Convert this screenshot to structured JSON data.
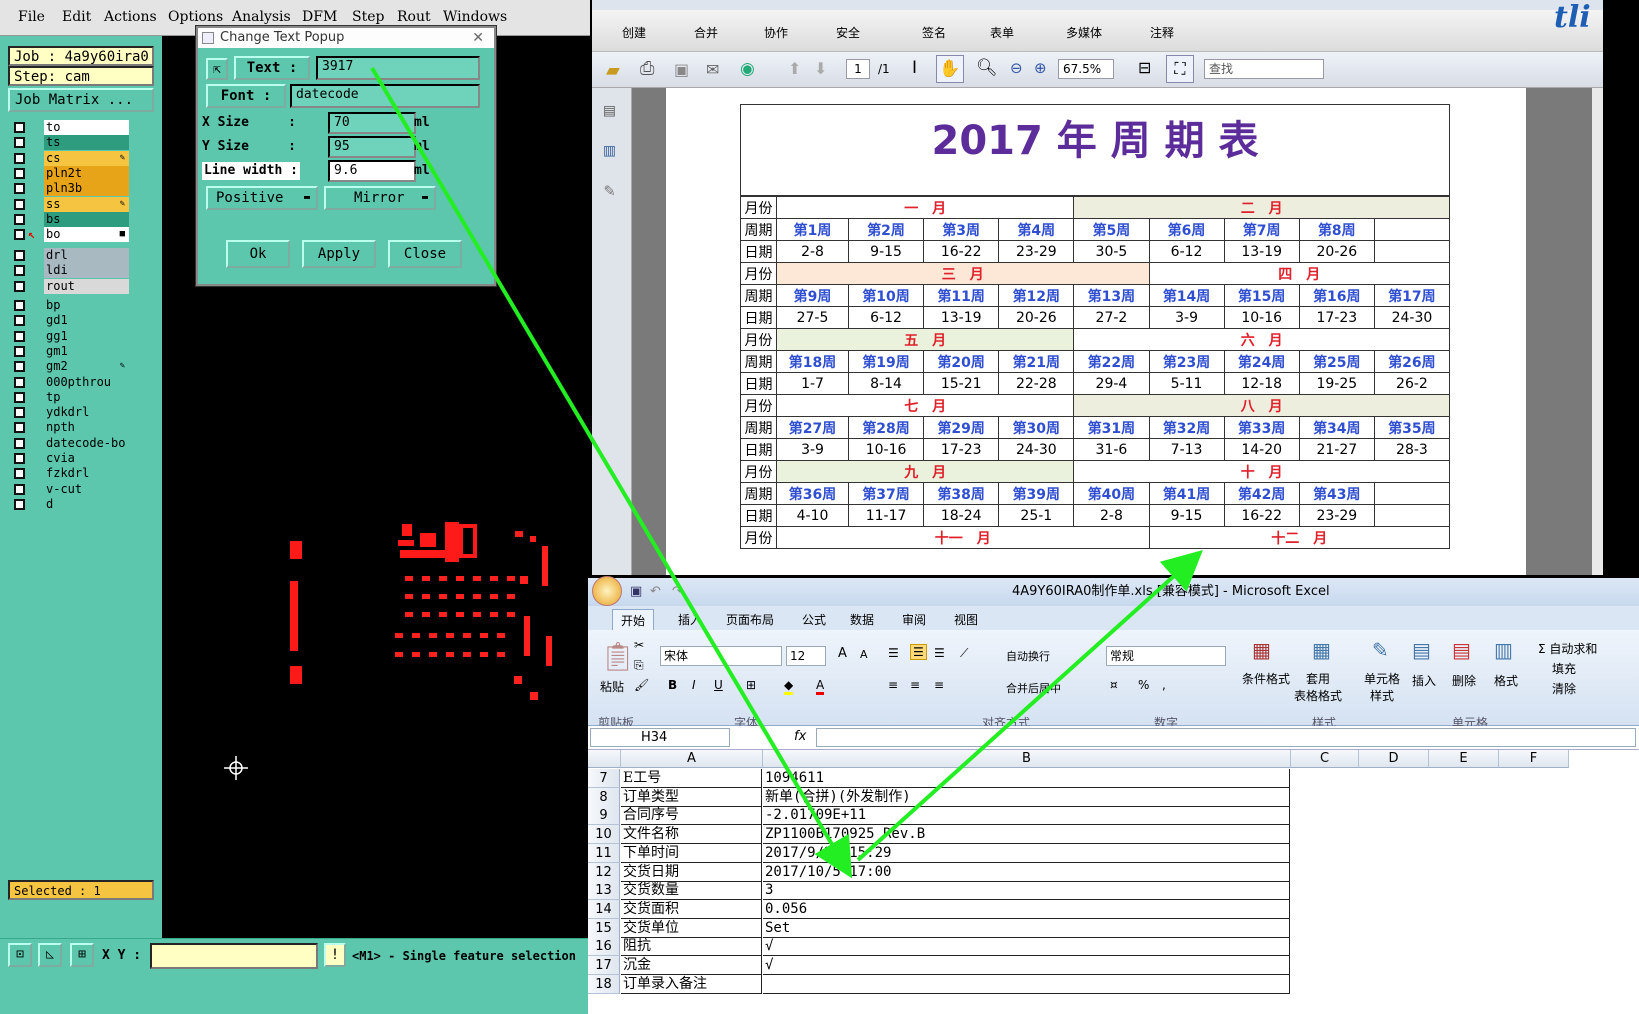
{
  "cam": {
    "menu": [
      "File",
      "Edit",
      "Actions",
      "Options",
      "Analysis",
      "DFM",
      "Step",
      "Rout",
      "Windows"
    ],
    "job": "Job : 4a9y60ira0",
    "step": "Step: cam",
    "job_matrix": "Job Matrix ...",
    "layers_a": [
      {
        "name": "to",
        "color": "#ffffff",
        "mark": ""
      },
      {
        "name": "ts",
        "color": "#2e9c7e",
        "mark": ""
      },
      {
        "name": "cs",
        "color": "#f5c542",
        "mark": "✎"
      },
      {
        "name": "pln2t",
        "color": "#e8a419",
        "mark": ""
      },
      {
        "name": "pln3b",
        "color": "#e8a419",
        "mark": ""
      },
      {
        "name": "ss",
        "color": "#f5c542",
        "mark": "✎"
      },
      {
        "name": "bs",
        "color": "#2e9c7e",
        "mark": ""
      },
      {
        "name": "bo",
        "color": "#ffffff",
        "mark": "■"
      }
    ],
    "layers_b": [
      {
        "name": "drl",
        "color": "#a8b9c2"
      },
      {
        "name": "ldi",
        "color": "#a8b9c2"
      },
      {
        "name": "rout",
        "color": "#d9d9d9"
      }
    ],
    "layers_c": [
      {
        "name": "bp",
        "mark": ""
      },
      {
        "name": "gd1",
        "mark": ""
      },
      {
        "name": "gg1",
        "mark": ""
      },
      {
        "name": "gm1",
        "mark": ""
      },
      {
        "name": "gm2",
        "mark": "✎"
      },
      {
        "name": "000pthrou",
        "mark": ""
      },
      {
        "name": "tp",
        "mark": ""
      },
      {
        "name": "ydkdrl",
        "mark": ""
      },
      {
        "name": "npth",
        "mark": ""
      },
      {
        "name": "datecode-bo",
        "mark": ""
      },
      {
        "name": "cvia",
        "mark": ""
      },
      {
        "name": "fzkdrl",
        "mark": ""
      },
      {
        "name": "v-cut",
        "mark": ""
      },
      {
        "name": "d",
        "mark": ""
      }
    ],
    "selected": "Selected : 1",
    "xy_label": "X Y :",
    "status": "<M1> - Single feature selection"
  },
  "dialog": {
    "title": "Change Text Popup",
    "text_label": "Text :",
    "text_value": "3917",
    "font_label": "Font :",
    "font_value": "datecode",
    "xsize_label": "X Size     :",
    "xsize_value": "70",
    "ysize_label": "Y Size     :",
    "ysize_value": "95",
    "linewidth_label": "Line width :",
    "linewidth_value": "9.6",
    "unit": "ml",
    "polarity": "Positive",
    "mirror": "Mirror",
    "ok": "Ok",
    "apply": "Apply",
    "close": "Close"
  },
  "pdf": {
    "toolbar": [
      "创建",
      "合并",
      "协作",
      "安全",
      "签名",
      "表单",
      "多媒体",
      "注释"
    ],
    "page_current": "1",
    "page_total": "/1",
    "zoom": "67.5%",
    "find_placeholder": "查找",
    "corner_text": "tli",
    "calendar_title": "2017 年 周 期 表",
    "row_month": "月份",
    "row_week": "周期",
    "row_date": "日期",
    "blocks": [
      {
        "months": [
          "一　月",
          "二　月"
        ],
        "split": 4,
        "weeks": [
          "第1周",
          "第2周",
          "第3周",
          "第4周",
          "第5周",
          "第6周",
          "第7周",
          "第8周",
          ""
        ],
        "dates": [
          "2-8",
          "9-15",
          "16-22",
          "23-29",
          "30-5",
          "6-12",
          "13-19",
          "20-26",
          ""
        ]
      },
      {
        "months": [
          "三　月",
          "四　月"
        ],
        "split": 5,
        "weeks": [
          "第9周",
          "第10周",
          "第11周",
          "第12周",
          "第13周",
          "第14周",
          "第15周",
          "第16周",
          "第17周"
        ],
        "dates": [
          "27-5",
          "6-12",
          "13-19",
          "20-26",
          "27-2",
          "3-9",
          "10-16",
          "17-23",
          "24-30"
        ]
      },
      {
        "months": [
          "五　月",
          "六　月"
        ],
        "split": 4,
        "weeks": [
          "第18周",
          "第19周",
          "第20周",
          "第21周",
          "第22周",
          "第23周",
          "第24周",
          "第25周",
          "第26周"
        ],
        "dates": [
          "1-7",
          "8-14",
          "15-21",
          "22-28",
          "29-4",
          "5-11",
          "12-18",
          "19-25",
          "26-2"
        ]
      },
      {
        "months": [
          "七　月",
          "八　月"
        ],
        "split": 4,
        "weeks": [
          "第27周",
          "第28周",
          "第29周",
          "第30周",
          "第31周",
          "第32周",
          "第33周",
          "第34周",
          "第35周"
        ],
        "dates": [
          "3-9",
          "10-16",
          "17-23",
          "24-30",
          "31-6",
          "7-13",
          "14-20",
          "21-27",
          "28-3"
        ]
      },
      {
        "months": [
          "九　月",
          "十　月"
        ],
        "split": 4,
        "weeks": [
          "第36周",
          "第37周",
          "第38周",
          "第39周",
          "第40周",
          "第41周",
          "第42周",
          "第43周",
          ""
        ],
        "dates": [
          "4-10",
          "11-17",
          "18-24",
          "25-1",
          "2-8",
          "9-15",
          "16-22",
          "23-29",
          ""
        ]
      }
    ],
    "last_months": [
      "十一　月",
      "十二　月"
    ]
  },
  "excel": {
    "title": "4A9Y60IRA0制作单.xls  [兼容模式] - Microsoft Excel",
    "tabs": [
      "开始",
      "插入",
      "页面布局",
      "公式",
      "数据",
      "审阅",
      "视图"
    ],
    "font_name": "宋体",
    "font_size": "12",
    "number_format": "常规",
    "ribbon_labels": {
      "paste": "粘贴",
      "clipboard": "剪贴板",
      "font": "字体",
      "align": "对齐方式",
      "number": "数字",
      "wrap": "自动换行",
      "merge": "合并后居中",
      "cond": "条件格式",
      "table": "套用\n表格格式",
      "cellstyle": "单元格\n样式",
      "styles": "样式",
      "insert": "插入",
      "delete": "删除",
      "format": "格式",
      "cells": "单元格",
      "autosum": "Σ 自动求和",
      "fill": "填充",
      "clear": "清除"
    },
    "name_box": "H34",
    "fx": "fx",
    "cols": [
      "A",
      "B",
      "C",
      "D",
      "E",
      "F"
    ],
    "rows": [
      {
        "n": "7",
        "a": "E工号",
        "b": "1094611"
      },
      {
        "n": "8",
        "a": "订单类型",
        "b": "新单(合拼)(外发制作)"
      },
      {
        "n": "9",
        "a": "合同序号",
        "b": "-2.01709E+11"
      },
      {
        "n": "10",
        "a": "文件名称",
        "b": "ZP1100B170925 Rev.B"
      },
      {
        "n": "11",
        "a": "下单时间",
        "b": "2017/9/26 15:29"
      },
      {
        "n": "12",
        "a": "交货日期",
        "b": "2017/10/5 17:00"
      },
      {
        "n": "13",
        "a": "交货数量",
        "b": "3"
      },
      {
        "n": "14",
        "a": "交货面积",
        "b": "0.056"
      },
      {
        "n": "15",
        "a": "交货单位",
        "b": "Set"
      },
      {
        "n": "16",
        "a": "阻抗",
        "b": "√"
      },
      {
        "n": "17",
        "a": "沉金",
        "b": "√"
      },
      {
        "n": "18",
        "a": "订单录入备注",
        "b": ""
      }
    ]
  },
  "colors": {
    "cam_teal": "#5cc7ad",
    "arrow": "#22ee22",
    "month_red": "#e0202a",
    "week_blue": "#2f4fd0"
  }
}
